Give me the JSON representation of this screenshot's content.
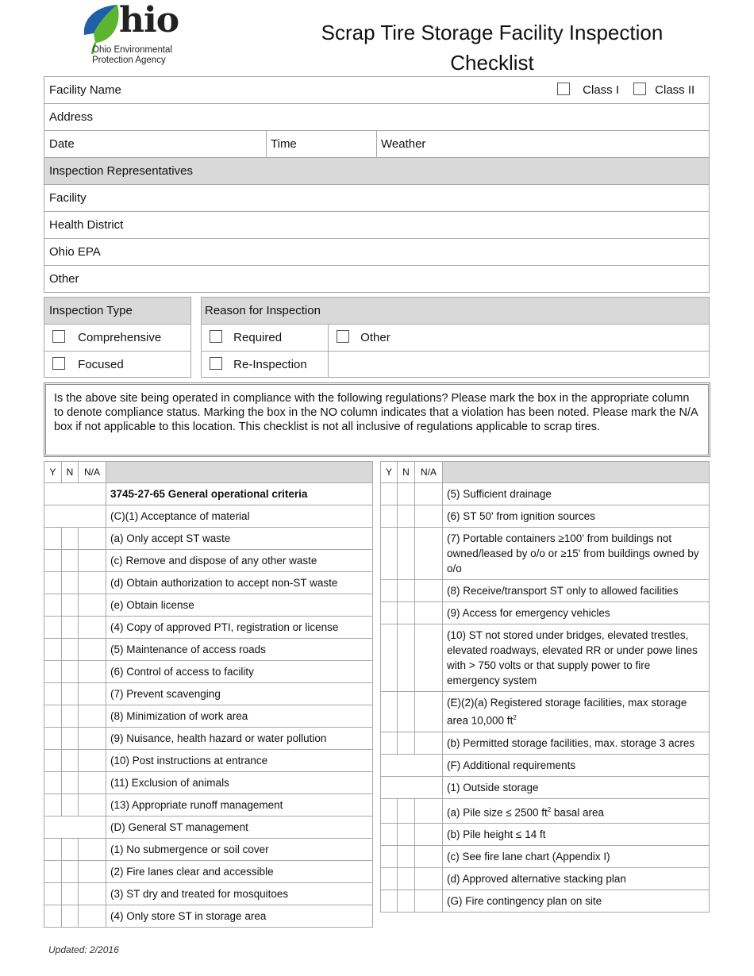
{
  "logo": {
    "word": "hio",
    "line1": "Ohio Environmental",
    "line2": "Protection Agency",
    "colors": {
      "blue": "#1f5fa8",
      "green": "#5cb531"
    }
  },
  "title": "Scrap Tire Storage Facility Inspection Checklist",
  "facility": {
    "name_label": "Facility Name",
    "class1_label": "Class I",
    "class2_label": "Class II",
    "address_label": "Address",
    "date_label": "Date",
    "time_label": "Time",
    "weather_label": "Weather"
  },
  "representatives": {
    "header": "Inspection Representatives",
    "rows": [
      "Facility",
      "Health District",
      "Ohio EPA",
      "Other"
    ]
  },
  "inspection_type": {
    "header": "Inspection Type",
    "options": [
      "Comprehensive",
      "Focused"
    ]
  },
  "reason": {
    "header": "Reason for Inspection",
    "options": [
      "Required",
      "Other",
      "Re-Inspection"
    ]
  },
  "intro_text": "Is the above site being operated  in compliance with the following regulations?  Please mark the box in the appropriate column to denote compliance status.  Marking the box in the NO column indicates that a violation has been noted.  Please mark the N/A box if not applicable to this location.  This checklist is not all inclusive of regulations applicable to scrap tires.",
  "columns": {
    "y": "Y",
    "n": "N",
    "na": "N/A"
  },
  "left_items": [
    {
      "text": "3745-27-65 General operational criteria",
      "type": "section"
    },
    {
      "text": "(C)(1)  Acceptance of material",
      "type": "subsection"
    },
    {
      "text": "(a) Only accept ST waste",
      "type": "item"
    },
    {
      "text": "(c) Remove and dispose of any other waste",
      "type": "item"
    },
    {
      "text": "(d) Obtain authorization to accept non-ST waste",
      "type": "item"
    },
    {
      "text": "(e) Obtain license",
      "type": "item"
    },
    {
      "text": "(4) Copy of approved PTI, registration or license",
      "type": "item"
    },
    {
      "text": "(5) Maintenance of access roads",
      "type": "item"
    },
    {
      "text": "(6) Control of access to facility",
      "type": "item"
    },
    {
      "text": "(7) Prevent scavenging",
      "type": "item"
    },
    {
      "text": "(8) Minimization of work area",
      "type": "item"
    },
    {
      "text": "(9) Nuisance, health hazard or water pollution",
      "type": "item"
    },
    {
      "text": "(10) Post instructions at entrance",
      "type": "item"
    },
    {
      "text": "(11) Exclusion of animals",
      "type": "item"
    },
    {
      "text": "(13) Appropriate runoff management",
      "type": "item"
    },
    {
      "text": "(D) General ST management",
      "type": "subsection"
    },
    {
      "text": "(1) No submergence or soil cover",
      "type": "item"
    },
    {
      "text": "(2) Fire lanes clear and accessible",
      "type": "item"
    },
    {
      "text": "(3) ST dry and treated for mosquitoes",
      "type": "item"
    },
    {
      "text": "(4) Only store ST in storage area",
      "type": "item"
    }
  ],
  "right_items": [
    {
      "text": "(5) Sufficient drainage",
      "type": "item"
    },
    {
      "text": "(6) ST 50' from ignition sources",
      "type": "item"
    },
    {
      "text": "(7) Portable containers ≥100' from buildings not owned/leased by o/o or ≥15' from buildings owned by o/o",
      "type": "item"
    },
    {
      "text": "(8) Receive/transport ST only to allowed facilities",
      "type": "item"
    },
    {
      "text": "(9) Access for emergency vehicles",
      "type": "item"
    },
    {
      "text": "(10) ST not stored under bridges, elevated trestles, elevated roadways, elevated RR or under powe lines with > 750 volts or that supply power to fire emergency system",
      "type": "item"
    },
    {
      "text": "(E)(2)(a) Registered storage facilities, max storage area 10,000 ft",
      "sup": "2",
      "type": "item"
    },
    {
      "text": "(b) Permitted storage facilities, max. storage 3 acres",
      "type": "item"
    },
    {
      "text": "(F) Additional requirements",
      "type": "subsection"
    },
    {
      "text": "(1) Outside storage",
      "type": "subsection"
    },
    {
      "text": "(a) Pile size ≤ 2500 ft",
      "sup": "2",
      "after": " basal area",
      "type": "item"
    },
    {
      "text": "(b) Pile height ≤ 14 ft",
      "type": "item"
    },
    {
      "text": "(c) See fire lane chart (Appendix I)",
      "type": "item"
    },
    {
      "text": "(d) Approved alternative stacking plan",
      "type": "item"
    },
    {
      "text": "(G) Fire contingency plan on site",
      "type": "item"
    }
  ],
  "footer": "Updated: 2/2016"
}
